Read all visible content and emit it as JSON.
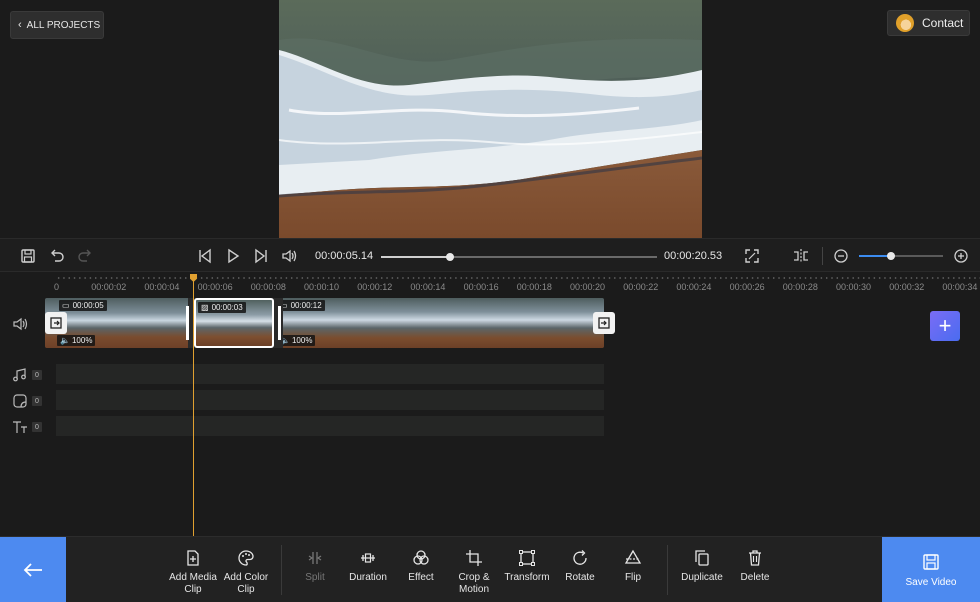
{
  "header": {
    "back_label": "ALL PROJECTS",
    "contact_label": "Contact"
  },
  "playback": {
    "current_time": "00:00:05.14",
    "total_time": "00:00:20.53",
    "seek_progress": 0.25,
    "zoom_level": 0.38
  },
  "ruler": {
    "ticks": [
      "0",
      "00:00:02",
      "00:00:04",
      "00:00:06",
      "00:00:08",
      "00:00:10",
      "00:00:12",
      "00:00:14",
      "00:00:16",
      "00:00:18",
      "00:00:20",
      "00:00:22",
      "00:00:24",
      "00:00:26",
      "00:00:28",
      "00:00:30",
      "00:00:32",
      "00:00:34"
    ]
  },
  "video_track": {
    "clips": [
      {
        "duration": "00:00:05",
        "kind": "video",
        "volume": "100%"
      },
      {
        "duration": "00:00:03",
        "kind": "image",
        "volume": ""
      },
      {
        "duration": "00:00:12",
        "kind": "video",
        "volume": "100%"
      }
    ]
  },
  "tracks": {
    "audio_count": "0",
    "sticker_count": "0",
    "text_count": "0"
  },
  "toolbar": {
    "add_media": "Add Media Clip",
    "add_color": "Add Color Clip",
    "split": "Split",
    "duration": "Duration",
    "effect": "Effect",
    "crop": "Crop & Motion",
    "transform": "Transform",
    "rotate": "Rotate",
    "flip": "Flip",
    "duplicate": "Duplicate",
    "delete": "Delete",
    "save": "Save Video"
  },
  "colors": {
    "accent": "#4d8af0",
    "playhead": "#e0a030",
    "add_button": "#6a6cf2"
  }
}
